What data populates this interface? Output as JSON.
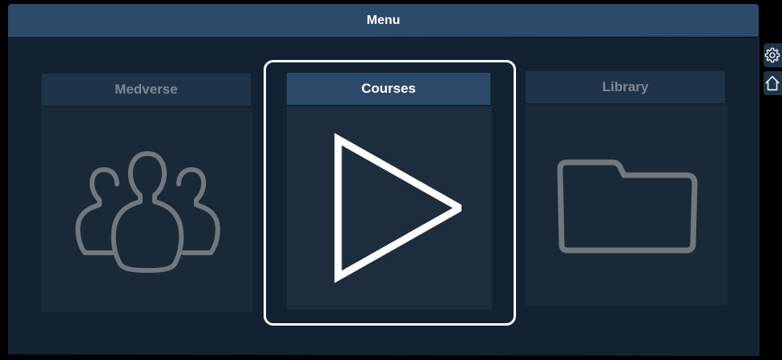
{
  "menu": {
    "title": "Menu",
    "cards": [
      {
        "label": "Medverse",
        "icon": "people-group-icon",
        "selected": false
      },
      {
        "label": "Courses",
        "icon": "play-icon",
        "selected": true
      },
      {
        "label": "Library",
        "icon": "folder-icon",
        "selected": false
      }
    ]
  },
  "side_buttons": [
    {
      "icon": "gear-icon"
    },
    {
      "icon": "home-icon"
    }
  ],
  "colors": {
    "title_bar": "#2b4a69",
    "panel": "#132232",
    "card_body": "#1b2b3b",
    "dim_text": "#7c8896",
    "active_text": "#ffffff",
    "selection": "#ffffff",
    "dim_icon": "#6f7881"
  }
}
